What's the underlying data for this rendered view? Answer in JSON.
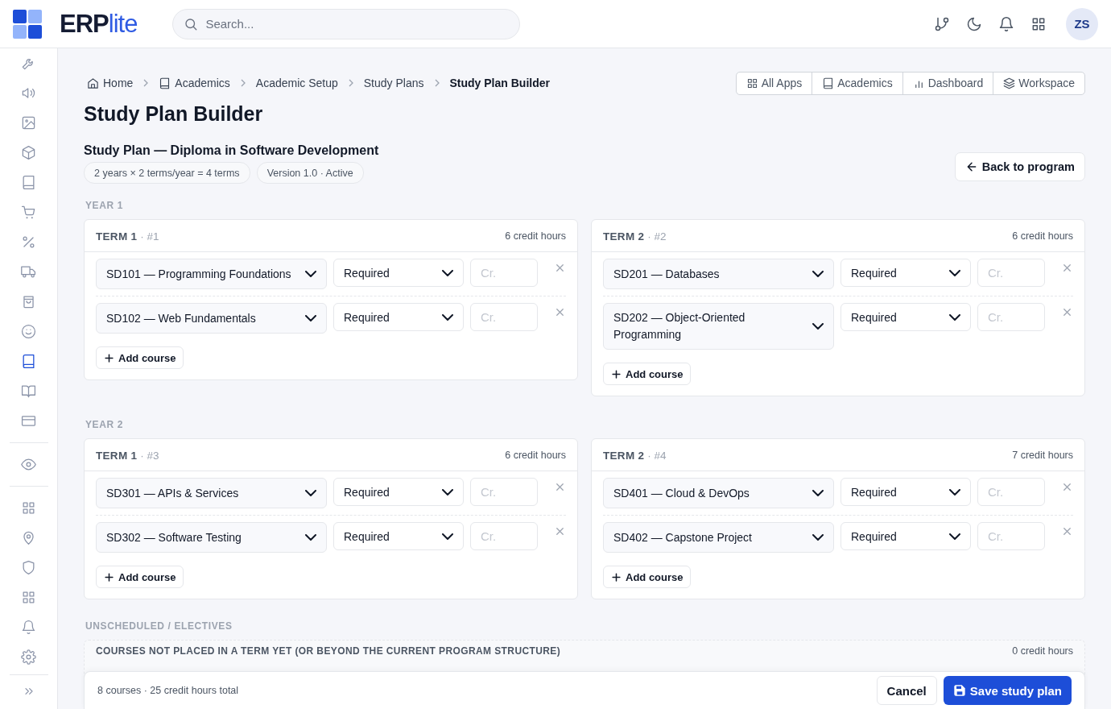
{
  "header": {
    "logo": {
      "strong": "ERP",
      "light": "lite"
    },
    "search": {
      "placeholder": "Search..."
    },
    "avatar": "ZS"
  },
  "sidebar": {
    "groups": [
      [
        {
          "kind": "wrench",
          "selected": false
        },
        {
          "kind": "speaker",
          "selected": false
        },
        {
          "kind": "image",
          "selected": false
        },
        {
          "kind": "cube",
          "selected": false
        },
        {
          "kind": "book",
          "selected": false
        },
        {
          "kind": "cart",
          "selected": false
        },
        {
          "kind": "percent",
          "selected": false
        },
        {
          "kind": "truck",
          "selected": false
        },
        {
          "kind": "bag",
          "selected": false
        },
        {
          "kind": "smiley",
          "selected": false
        },
        {
          "kind": "book",
          "selected": true
        },
        {
          "kind": "open-book",
          "selected": false
        },
        {
          "kind": "credit-card",
          "selected": false
        }
      ],
      [
        {
          "kind": "eye",
          "selected": false
        }
      ],
      [
        {
          "kind": "grid",
          "selected": false
        },
        {
          "kind": "pin",
          "selected": false
        },
        {
          "kind": "shield",
          "selected": false
        },
        {
          "kind": "grid",
          "selected": false
        },
        {
          "kind": "bell",
          "selected": false
        },
        {
          "kind": "gear",
          "selected": false
        }
      ]
    ]
  },
  "breadcrumb": [
    {
      "label": "Home",
      "kind": "home",
      "current": false
    },
    {
      "label": "Academics",
      "kind": "book",
      "current": false
    },
    {
      "label": "Academic Setup",
      "kind": "plain",
      "current": false
    },
    {
      "label": "Study Plans",
      "kind": "plain",
      "current": false
    },
    {
      "label": "Study Plan Builder",
      "kind": "plain",
      "current": true
    }
  ],
  "app_links": [
    {
      "label": "All Apps",
      "kind": "grid"
    },
    {
      "label": "Academics",
      "kind": "book"
    },
    {
      "label": "Dashboard",
      "kind": "bars"
    },
    {
      "label": "Workspace",
      "kind": "layers"
    }
  ],
  "page_title": "Study Plan Builder",
  "plan": {
    "title": "Study Plan — Diploma in Software Development",
    "chips": [
      "2 years × 2 terms/year = 4 terms",
      "Version 1.0 · Active"
    ],
    "back_button": "Back to program"
  },
  "years": [
    {
      "label": "YEAR 1",
      "terms": [
        {
          "name": "TERM 1",
          "number": "· #1",
          "credits": "6 credit hours",
          "add_label": "Add course",
          "courses": [
            {
              "course": "SD101 — Programming Foundations",
              "type": "Required",
              "credit_placeholder": "Cr."
            },
            {
              "course": "SD102 — Web Fundamentals",
              "type": "Required",
              "credit_placeholder": "Cr."
            }
          ]
        },
        {
          "name": "TERM 2",
          "number": "· #2",
          "credits": "6 credit hours",
          "add_label": "Add course",
          "courses": [
            {
              "course": "SD201 — Databases",
              "type": "Required",
              "credit_placeholder": "Cr."
            },
            {
              "course": "SD202 — Object-Oriented Programming",
              "type": "Required",
              "credit_placeholder": "Cr."
            }
          ]
        }
      ]
    },
    {
      "label": "YEAR 2",
      "terms": [
        {
          "name": "TERM 1",
          "number": "· #3",
          "credits": "6 credit hours",
          "add_label": "Add course",
          "courses": [
            {
              "course": "SD301 — APIs & Services",
              "type": "Required",
              "credit_placeholder": "Cr."
            },
            {
              "course": "SD302 — Software Testing",
              "type": "Required",
              "credit_placeholder": "Cr."
            }
          ]
        },
        {
          "name": "TERM 2",
          "number": "· #4",
          "credits": "7 credit hours",
          "add_label": "Add course",
          "courses": [
            {
              "course": "SD401 — Cloud & DevOps",
              "type": "Required",
              "credit_placeholder": "Cr."
            },
            {
              "course": "SD402 — Capstone Project",
              "type": "Required",
              "credit_placeholder": "Cr."
            }
          ]
        }
      ]
    }
  ],
  "unscheduled": {
    "label": "UNSCHEDULED / ELECTIVES",
    "description": "COURSES NOT PLACED IN A TERM YET (OR BEYOND THE CURRENT PROGRAM STRUCTURE)",
    "credits": "0 credit hours"
  },
  "footer": {
    "summary": "8 courses · 25 credit hours total",
    "cancel": "Cancel",
    "save": "Save study plan"
  }
}
